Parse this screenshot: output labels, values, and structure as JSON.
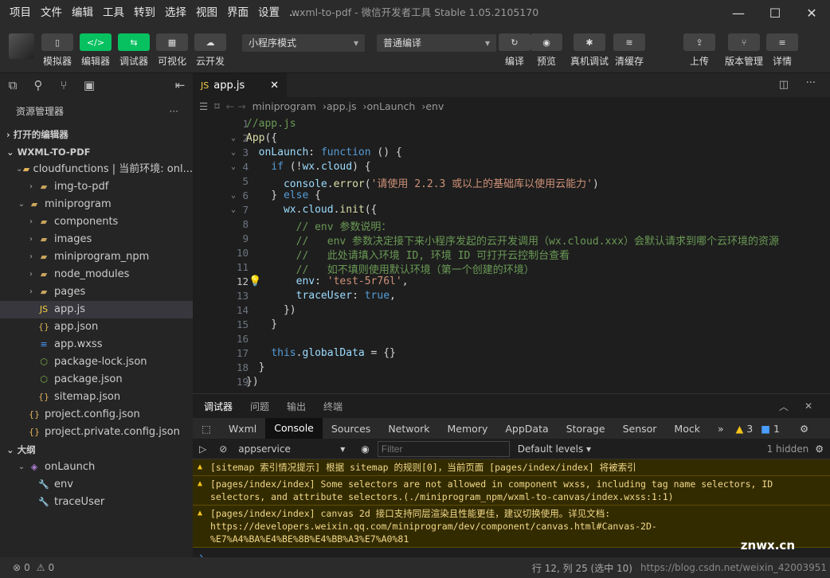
{
  "menu": [
    "项目",
    "文件",
    "编辑",
    "工具",
    "转到",
    "选择",
    "视图",
    "界面",
    "设置",
    "..."
  ],
  "window_title": "wxml-to-pdf - 微信开发者工具 Stable 1.05.2105170",
  "toolbar": {
    "left": [
      "模拟器",
      "编辑器",
      "调试器",
      "可视化",
      "云开发"
    ],
    "mode": "小程序模式",
    "compile_mode": "普通编译",
    "middle": [
      "编译",
      "预览",
      "真机调试",
      "清缓存"
    ],
    "right": [
      "上传",
      "版本管理",
      "详情"
    ]
  },
  "sidebar": {
    "title": "资源管理器",
    "open_editors": "打开的编辑器",
    "project": "WXML-TO-PDF",
    "tree": [
      {
        "label": "cloudfunctions | 当前环境: onl...",
        "indent": 1,
        "icon": "folder-cloud-icon"
      },
      {
        "label": "img-to-pdf",
        "indent": 2,
        "icon": "folder-icon"
      },
      {
        "label": "miniprogram",
        "indent": 1,
        "icon": "folder-icon"
      },
      {
        "label": "components",
        "indent": 2,
        "icon": "folder-icon"
      },
      {
        "label": "images",
        "indent": 2,
        "icon": "folder-icon"
      },
      {
        "label": "miniprogram_npm",
        "indent": 2,
        "icon": "folder-icon"
      },
      {
        "label": "node_modules",
        "indent": 2,
        "icon": "folder-icon"
      },
      {
        "label": "pages",
        "indent": 2,
        "icon": "folder-icon"
      },
      {
        "label": "app.js",
        "indent": 2,
        "icon": "js-file-icon"
      },
      {
        "label": "app.json",
        "indent": 2,
        "icon": "json-file-icon"
      },
      {
        "label": "app.wxss",
        "indent": 2,
        "icon": "css-file-icon"
      },
      {
        "label": "package-lock.json",
        "indent": 2,
        "icon": "package-icon"
      },
      {
        "label": "package.json",
        "indent": 2,
        "icon": "package-icon"
      },
      {
        "label": "sitemap.json",
        "indent": 2,
        "icon": "json-file-icon"
      },
      {
        "label": "project.config.json",
        "indent": 1,
        "icon": "json-file-icon"
      },
      {
        "label": "project.private.config.json",
        "indent": 1,
        "icon": "json-file-icon"
      }
    ],
    "outline_title": "大纲",
    "outline": [
      {
        "label": "onLaunch",
        "indent": 1
      },
      {
        "label": "env",
        "indent": 2
      },
      {
        "label": "traceUser",
        "indent": 2
      }
    ]
  },
  "editor": {
    "tab": "app.js",
    "breadcrumb": [
      "miniprogram",
      "app.js",
      "onLaunch",
      "env"
    ],
    "lines": [
      "//app.js",
      "App({",
      "  onLaunch: function () {",
      "    if (!wx.cloud) {",
      "      console.error('请使用 2.2.3 或以上的基础库以使用云能力')",
      "    } else {",
      "      wx.cloud.init({",
      "        // env 参数说明：",
      "        //   env 参数决定接下来小程序发起的云开发调用（wx.cloud.xxx）会默认请求到哪个云环境的资源",
      "        //   此处请填入环境 ID, 环境 ID 可打开云控制台查看",
      "        //   如不填则使用默认环境（第一个创建的环境）",
      "        env: 'test-5r76l',",
      "        traceUser: true,",
      "      })",
      "    }",
      "",
      "    this.globalData = {}",
      "  }",
      "})"
    ]
  },
  "panel": {
    "tabs": [
      "调试器",
      "问题",
      "输出",
      "终端"
    ],
    "devtools": [
      "Wxml",
      "Console",
      "Sources",
      "Network",
      "Memory",
      "AppData",
      "Storage",
      "Sensor",
      "Mock"
    ],
    "warn_count": "3",
    "info_count": "1",
    "context": "appservice",
    "filter_placeholder": "Filter",
    "levels": "Default levels",
    "hidden": "1 hidden",
    "messages": [
      "[sitemap 索引情况提示] 根据 sitemap 的规则[0]，当前页面 [pages/index/index] 将被索引",
      "[pages/index/index] Some selectors are not allowed in component wxss, including tag name selectors, ID selectors, and attribute selectors.(./miniprogram_npm/wxml-to-canvas/index.wxss:1:1)",
      "[pages/index/index] canvas 2d 接口支持同层渲染且性能更佳，建议切换使用。详见文档: https://developers.weixin.qq.com/miniprogram/dev/component/canvas.html#Canvas-2D-%E7%A4%BA%E4%BE%8B%E4%BB%A3%E7%A0%81"
    ]
  },
  "status": {
    "errors": "0",
    "warnings": "0",
    "position": "行 12, 列 25 (选中 10)",
    "watermark": "https://blog.csdn.net/weixin_42003951",
    "logo": "znwx.cn"
  }
}
